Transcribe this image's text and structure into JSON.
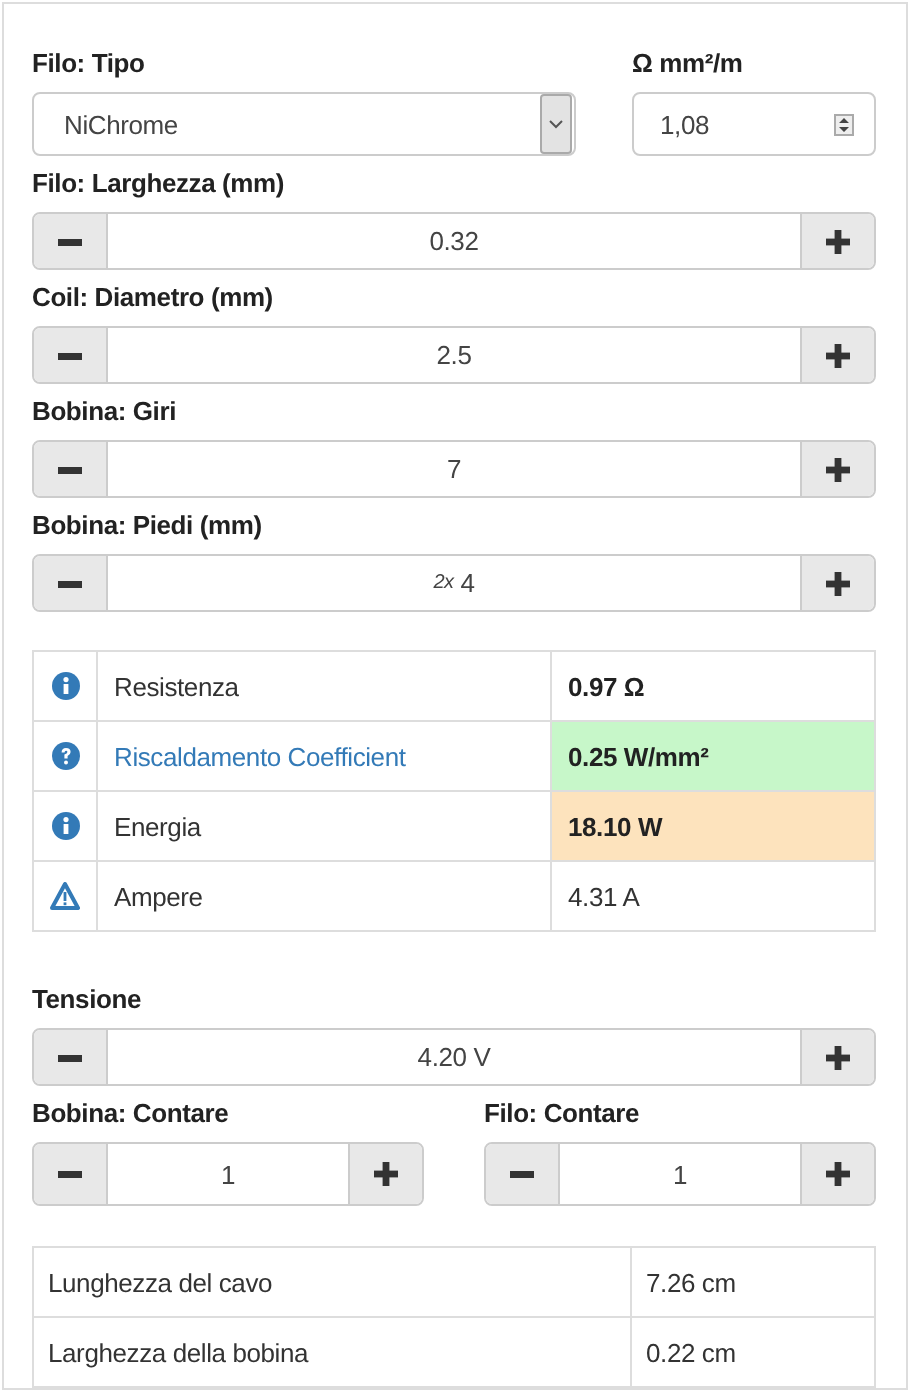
{
  "wire_type": {
    "label": "Filo: Tipo",
    "value": "NiChrome"
  },
  "resistivity": {
    "label": "Ω mm²/m",
    "value": "1,08"
  },
  "spinners": [
    {
      "label": "Filo: Larghezza (mm)",
      "value": "0.32"
    },
    {
      "label": "Coil: Diametro (mm)",
      "value": "2.5"
    },
    {
      "label": "Bobina: Giri",
      "value": "7"
    },
    {
      "label": "Bobina: Piedi (mm)",
      "prefix": "2x",
      "value": "4"
    }
  ],
  "results": [
    {
      "kind": "info",
      "label": "Resistenza",
      "link": false,
      "value": "0.97 Ω",
      "bold": true
    },
    {
      "kind": "question",
      "label": "Riscaldamento Coefficient",
      "link": true,
      "value": "0.25 W/mm²",
      "bold": true,
      "color": "#c7f7c9"
    },
    {
      "kind": "info",
      "label": "Energia",
      "link": false,
      "value": "18.10 W",
      "bold": true,
      "color": "#fde3bd"
    },
    {
      "kind": "warning",
      "label": "Ampere",
      "link": false,
      "value": "4.31 A",
      "bold": false
    }
  ],
  "voltage": {
    "label": "Tensione",
    "value": "4.20 V"
  },
  "counts": [
    {
      "label": "Bobina: Contare",
      "value": "1"
    },
    {
      "label": "Filo: Contare",
      "value": "1"
    }
  ],
  "summary": [
    {
      "label": "Lunghezza del cavo",
      "value": "7.26 cm"
    },
    {
      "label": "Larghezza della bobina",
      "value": "0.22 cm"
    }
  ]
}
